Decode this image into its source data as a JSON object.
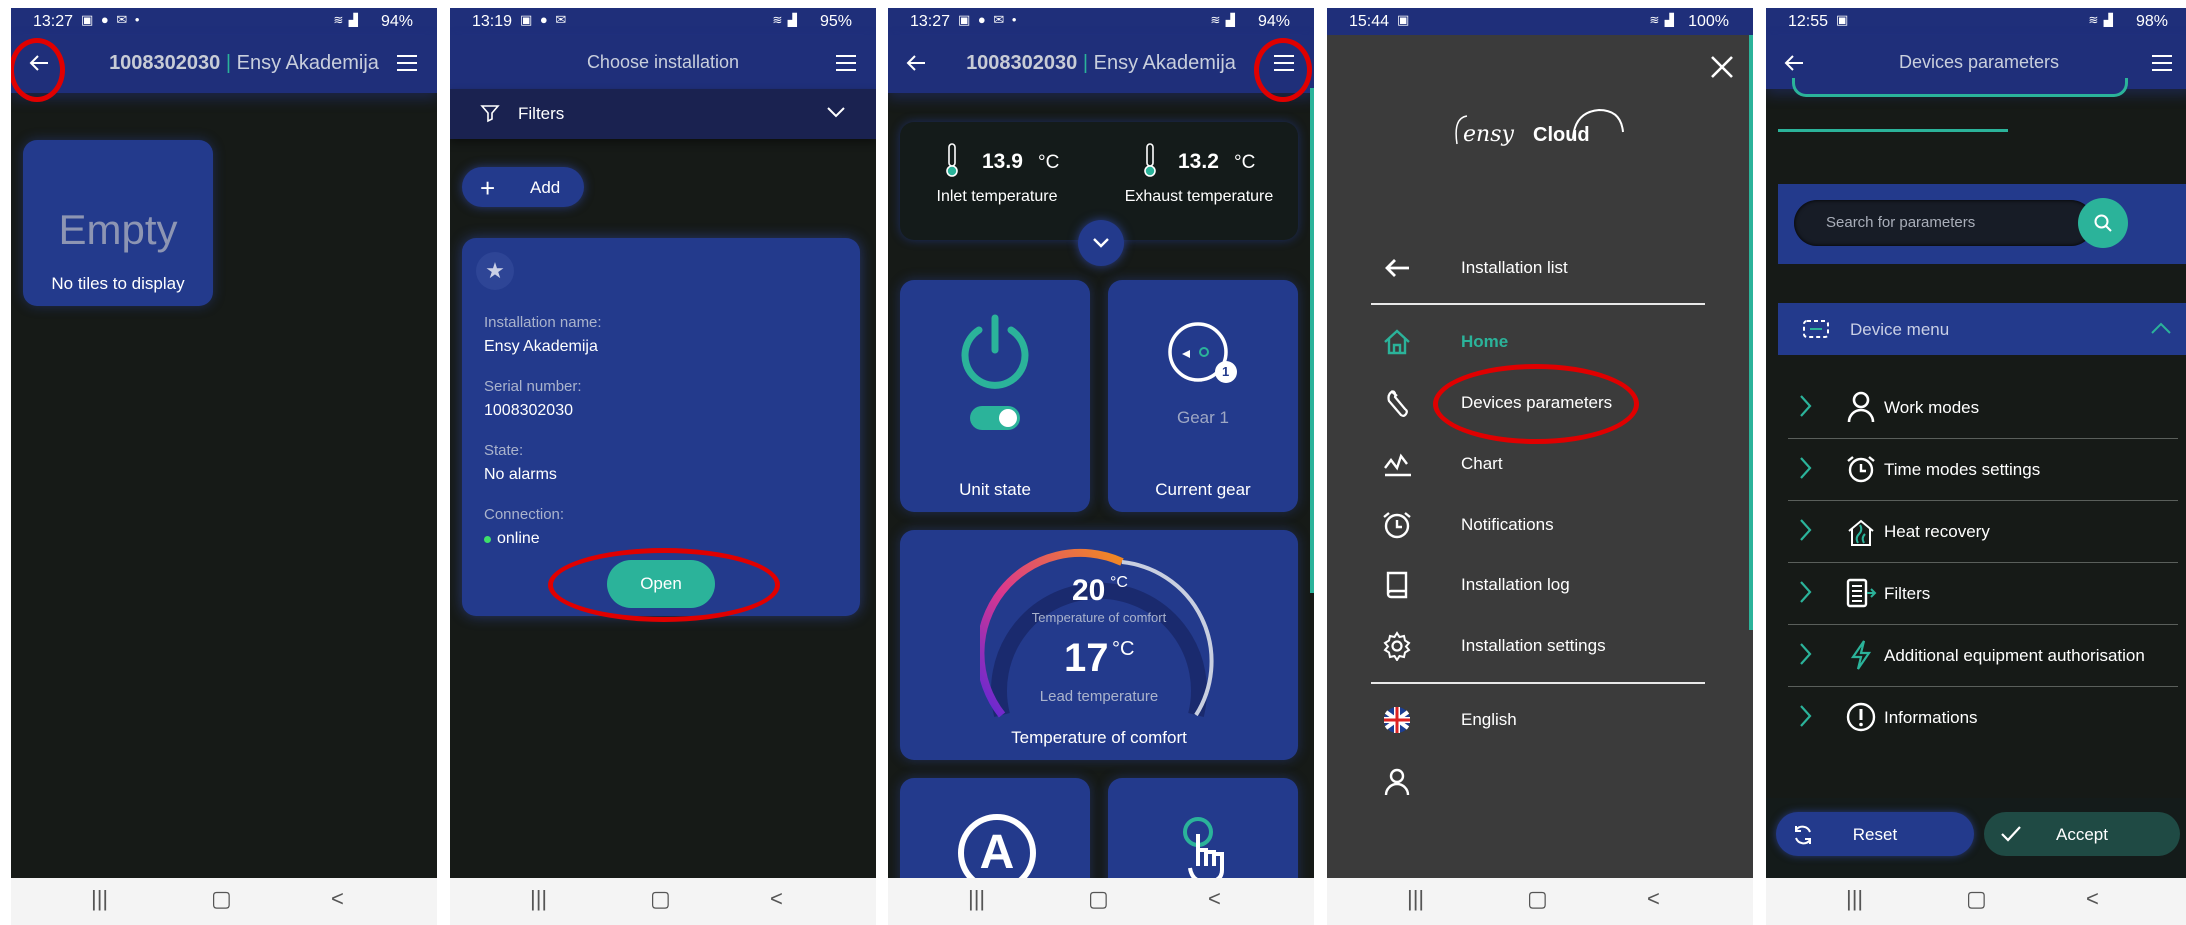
{
  "phones": [
    {
      "status": {
        "time": "13:27",
        "battery": "94%"
      },
      "header": {
        "serial": "1008302030",
        "separator": "|",
        "name": "Ensy Akademija"
      },
      "tile": {
        "title": "Empty",
        "text": "No tiles to display"
      }
    },
    {
      "status": {
        "time": "13:19",
        "battery": "95%"
      },
      "header": {
        "title": "Choose installation"
      },
      "filters_label": "Filters",
      "add_label": "Add",
      "card": {
        "name_label": "Installation name:",
        "name_value": "Ensy Akademija",
        "serial_label": "Serial number:",
        "serial_value": "1008302030",
        "state_label": "State:",
        "state_value": "No alarms",
        "connection_label": "Connection:",
        "connection_value": "online",
        "open_label": "Open"
      }
    },
    {
      "status": {
        "time": "13:27",
        "battery": "94%"
      },
      "header": {
        "serial": "1008302030",
        "separator": "|",
        "name": "Ensy Akademija"
      },
      "inlet": {
        "value": "13.9",
        "unit": "°C",
        "label": "Inlet temperature"
      },
      "exhaust": {
        "value": "13.2",
        "unit": "°C",
        "label": "Exhaust temperature"
      },
      "unit_state_label": "Unit state",
      "gear_text": "Gear 1",
      "gear_badge": "1",
      "current_gear_label": "Current gear",
      "comfort": {
        "value": "20",
        "unit": "°C",
        "sublabel": "Temperature of comfort",
        "lead_value": "17",
        "lead_unit": "°C",
        "lead_label": "Lead temperature",
        "tile_label": "Temperature of comfort"
      },
      "auto_letter": "A"
    },
    {
      "status": {
        "time": "15:44",
        "battery": "100%"
      },
      "logo": {
        "brand": "ensy",
        "cloud": "Cloud"
      },
      "menu": {
        "installation_list": "Installation list",
        "home": "Home",
        "devices_parameters": "Devices parameters",
        "chart": "Chart",
        "notifications": "Notifications",
        "installation_log": "Installation log",
        "installation_settings": "Installation settings",
        "language": "English"
      }
    },
    {
      "status": {
        "time": "12:55",
        "battery": "98%"
      },
      "header": {
        "title": "Devices parameters"
      },
      "search_placeholder": "Search for parameters",
      "device_menu": "Device menu",
      "params": [
        "Work modes",
        "Time modes settings",
        "Heat recovery",
        "Filters",
        "Additional equipment authorisation",
        "Informations"
      ],
      "reset_label": "Reset",
      "accept_label": "Accept"
    }
  ],
  "colors": {
    "navy": "#1f2f7a",
    "tile": "#233a8c",
    "teal": "#2bb39a",
    "dark": "#161a17",
    "red": "#e00000"
  }
}
